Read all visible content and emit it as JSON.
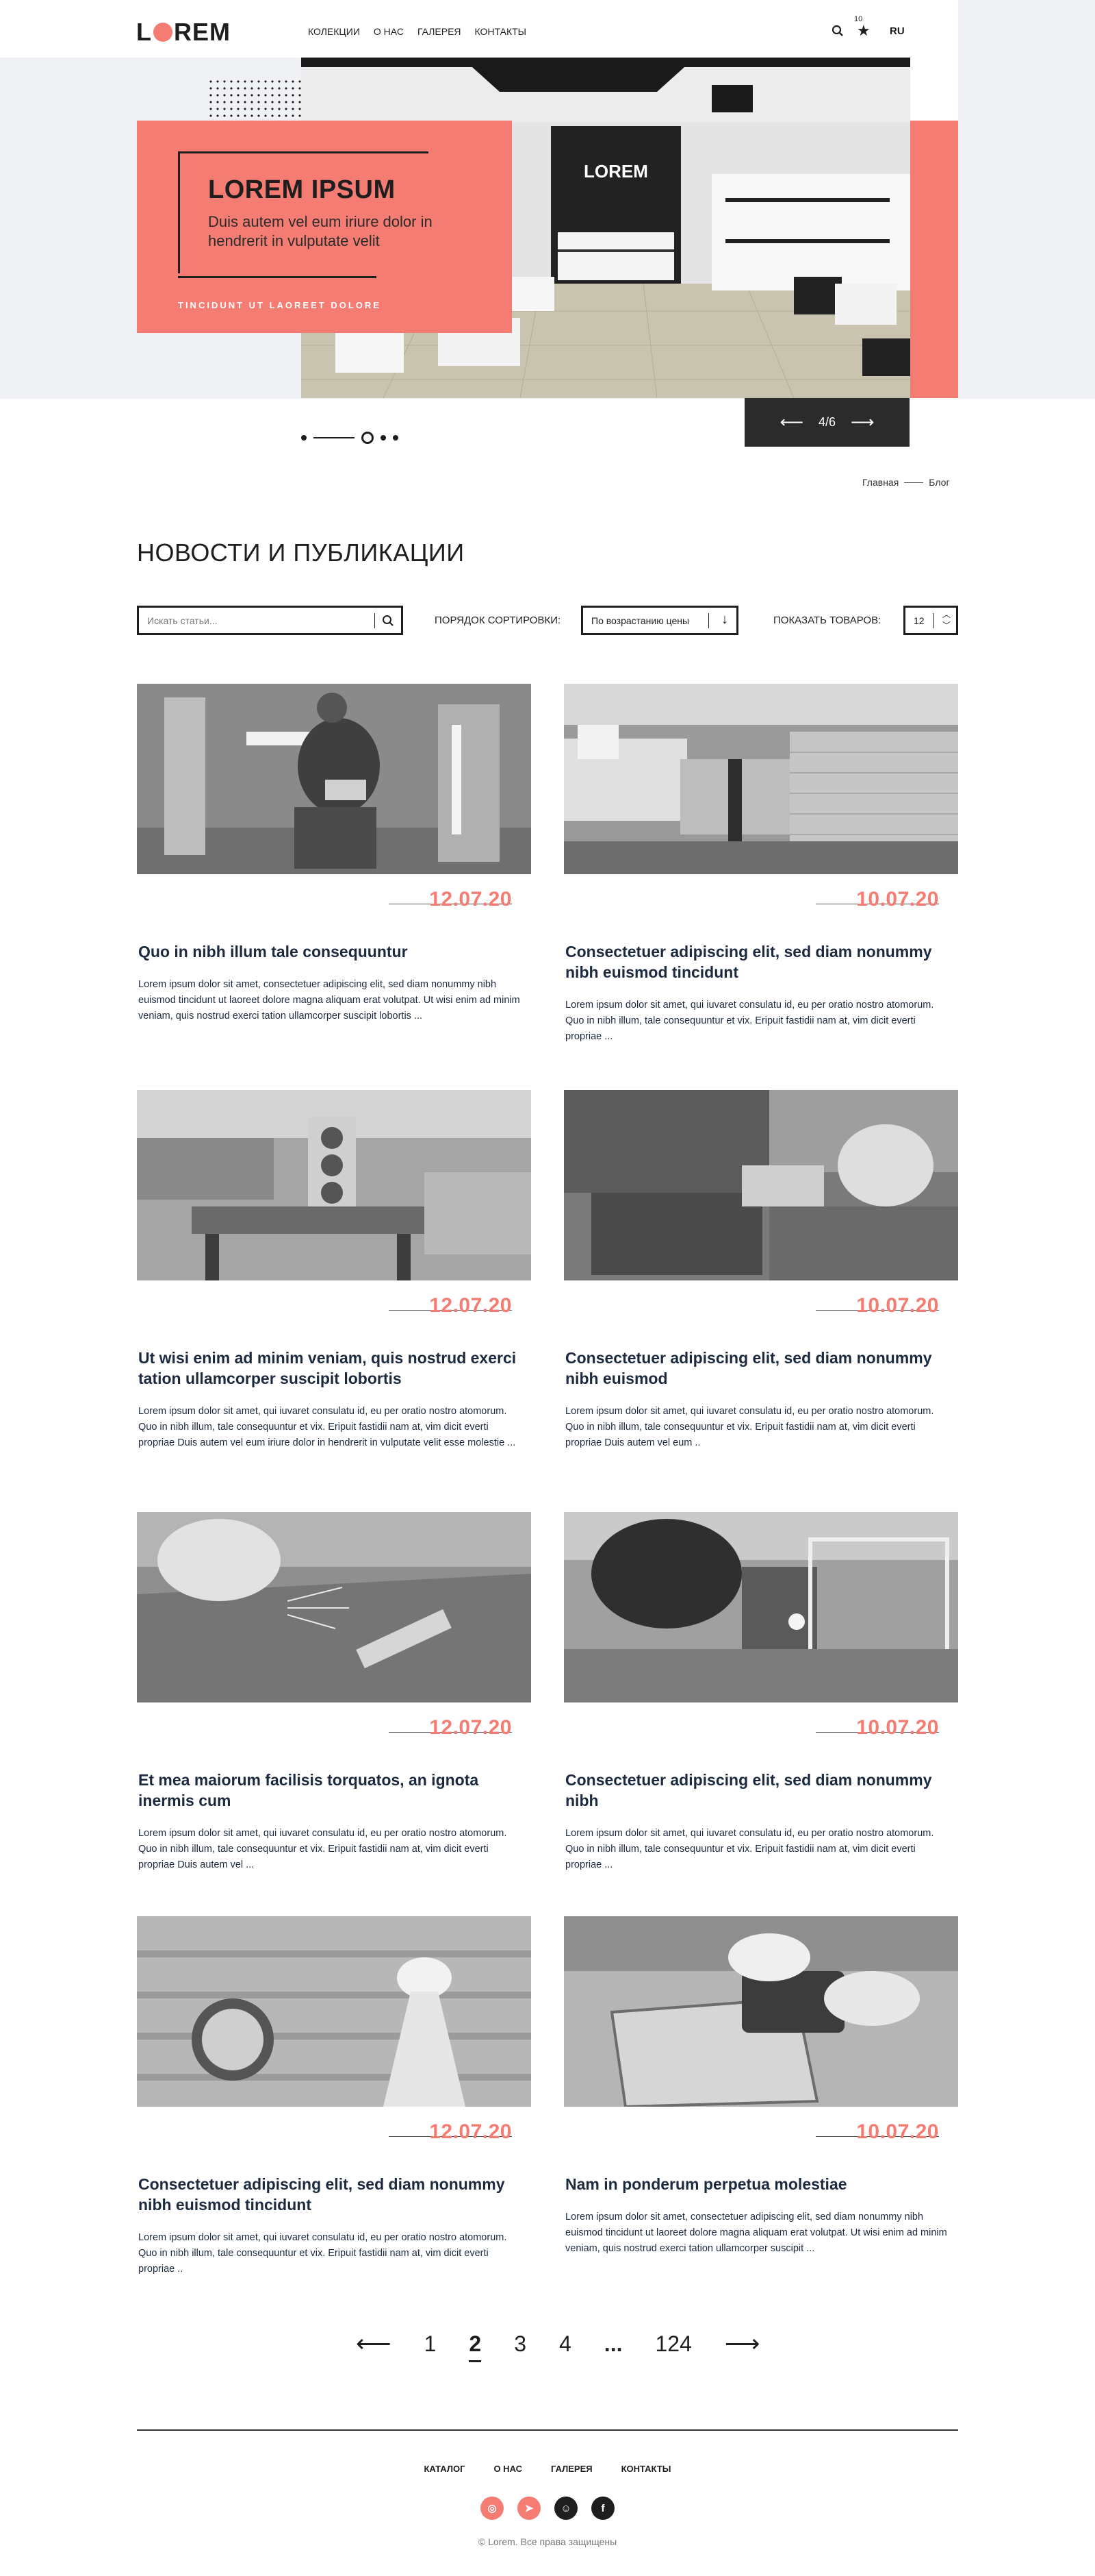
{
  "header": {
    "logo": "LOREM",
    "nav": [
      "КОЛЕКЦИИ",
      "О НАС",
      "ГАЛЕРЕЯ",
      "КОНТАКТЫ"
    ],
    "favorites_count": "10",
    "lang": "RU"
  },
  "hero": {
    "title": "LOREM IPSUM",
    "subtitle": "Duis autem vel eum iriure dolor in hendrerit in vulputate velit",
    "cta": "TINCIDUNT UT LAOREET DOLORE",
    "sign": "LOREM",
    "slide_counter": "4/6"
  },
  "breadcrumbs": {
    "home": "Главная",
    "current": "Блог"
  },
  "page_title": "НОВОСТИ И ПУБЛИКАЦИИ",
  "controls": {
    "search_placeholder": "Искать статьи...",
    "sort_label": "ПОРЯДОК СОРТИРОВКИ:",
    "sort_value": "По возрастанию цены",
    "show_label": "ПОКАЗАТЬ ТОВАРОВ:",
    "show_value": "12"
  },
  "articles": [
    {
      "date": "12.07.20",
      "title": "Quo in nibh illum tale consequuntur",
      "text": "Lorem ipsum dolor sit amet, consectetuer adipiscing elit, sed diam nonummy nibh euismod tincidunt ut laoreet dolore magna aliquam erat volutpat. Ut wisi enim ad minim veniam, quis nostrud exerci tation ullamcorper suscipit lobortis ..."
    },
    {
      "date": "10.07.20",
      "title": "Consectetuer adipiscing elit, sed diam nonummy nibh euismod tincidunt",
      "text": "Lorem ipsum dolor sit amet, qui iuvaret consulatu id, eu per oratio nostro atomorum. Quo in nibh illum, tale consequuntur et vix. Eripuit fastidii nam at, vim dicit everti propriae ..."
    },
    {
      "date": "12.07.20",
      "title": "Ut wisi enim ad minim veniam, quis nostrud exerci tation ullamcorper suscipit lobortis",
      "text": "Lorem ipsum dolor sit amet, qui iuvaret consulatu id, eu per oratio nostro atomorum. Quo in nibh illum, tale consequuntur et vix. Eripuit fastidii nam at, vim dicit everti propriae Duis autem vel eum iriure dolor in hendrerit in vulputate velit esse molestie ..."
    },
    {
      "date": "10.07.20",
      "title": "Consectetuer adipiscing elit, sed diam nonummy nibh euismod",
      "text": "Lorem ipsum dolor sit amet, qui iuvaret consulatu id, eu per oratio nostro atomorum. Quo in nibh illum, tale consequuntur et vix. Eripuit fastidii nam at, vim dicit everti propriae Duis autem vel eum .."
    },
    {
      "date": "12.07.20",
      "title": "Et mea maiorum facilisis torquatos, an ignota inermis cum",
      "text": "Lorem ipsum dolor sit amet, qui iuvaret consulatu id, eu per oratio nostro atomorum. Quo in nibh illum, tale consequuntur et vix. Eripuit fastidii nam at, vim dicit everti propriae Duis autem vel ..."
    },
    {
      "date": "10.07.20",
      "title": "Consectetuer adipiscing elit, sed diam nonummy nibh",
      "text": "Lorem ipsum dolor sit amet, qui iuvaret consulatu id, eu per oratio nostro atomorum. Quo in nibh illum, tale consequuntur et vix. Eripuit fastidii nam at, vim dicit everti propriae ..."
    },
    {
      "date": "12.07.20",
      "title": "Consectetuer adipiscing elit, sed diam nonummy nibh euismod tincidunt",
      "text": "Lorem ipsum dolor sit amet, qui iuvaret consulatu id, eu per oratio nostro atomorum. Quo in nibh illum, tale consequuntur et vix. Eripuit fastidii nam at, vim dicit everti propriae .."
    },
    {
      "date": "10.07.20",
      "title": "Nam in ponderum perpetua molestiae",
      "text": "Lorem ipsum dolor sit amet, consectetuer adipiscing elit, sed diam nonummy nibh euismod tincidunt ut laoreet dolore magna aliquam erat volutpat. Ut wisi enim ad minim veniam, quis nostrud exerci tation ullamcorper suscipit  ..."
    }
  ],
  "pagination": {
    "pages": [
      "1",
      "2",
      "3",
      "4",
      "...",
      "124"
    ],
    "current": "2"
  },
  "footer": {
    "nav": [
      "КАТАЛОГ",
      "О НАС",
      "ГАЛЕРЕЯ",
      "КОНТАКТЫ"
    ],
    "copyright": "© Lorem. Все права защищены"
  },
  "colors": {
    "accent": "#f47c72",
    "dark": "#1e1e1e",
    "hero_bg": "#f0f1f4",
    "title_navy": "#1b2a3f"
  },
  "icons": {
    "social": [
      "instagram-icon",
      "telegram-icon",
      "odnoklassniki-icon",
      "facebook-icon"
    ],
    "social_colors": [
      "#f47c72",
      "#f47c72",
      "#1e1e1e",
      "#1e1e1e"
    ]
  }
}
